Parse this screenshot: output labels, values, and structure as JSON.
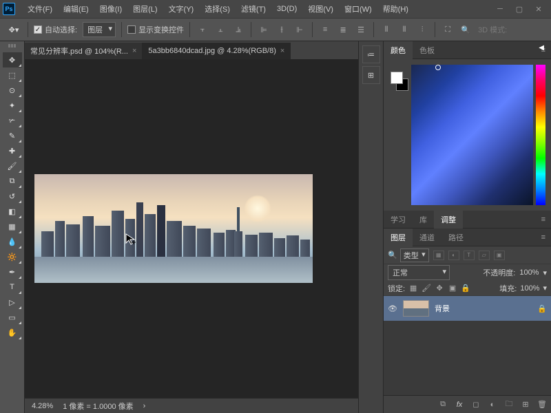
{
  "menu": {
    "file": "文件(F)",
    "edit": "编辑(E)",
    "image": "图像(I)",
    "layer": "图层(L)",
    "type": "文字(Y)",
    "select": "选择(S)",
    "filter": "滤镜(T)",
    "3d": "3D(D)",
    "view": "视图(V)",
    "window": "窗口(W)",
    "help": "帮助(H)"
  },
  "options": {
    "autoselect": "自动选择:",
    "autoselect_target": "图层",
    "transform": "显示变换控件",
    "mode3d": "3D 模式:"
  },
  "tabs": [
    {
      "label": "常见分辨率.psd @ 104%(R...",
      "active": false
    },
    {
      "label": "5a3bb6840dcad.jpg @ 4.28%(RGB/8)",
      "active": true
    }
  ],
  "status": {
    "zoom": "4.28%",
    "pixel": "1 像素 = 1.0000 像素"
  },
  "panels": {
    "color": "颜色",
    "swatch": "色板",
    "learn": "学习",
    "lib": "库",
    "adjust": "调整",
    "layers": "图层",
    "channels": "通道",
    "paths": "路径",
    "kind": "类型",
    "blend": "正常",
    "opacity_label": "不透明度:",
    "opacity": "100%",
    "lock_label": "锁定:",
    "fill_label": "填充:",
    "fill": "100%",
    "bg_layer": "背景"
  }
}
